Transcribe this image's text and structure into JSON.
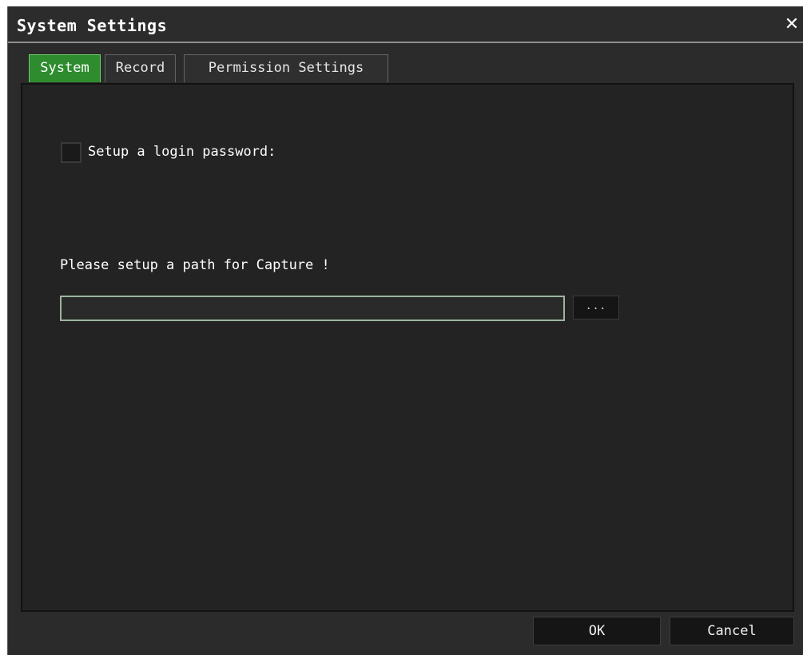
{
  "window": {
    "title": "System Settings",
    "close_glyph": "✕"
  },
  "tabs": [
    {
      "label": "System",
      "active": true
    },
    {
      "label": "Record",
      "active": false
    },
    {
      "label": "Permission Settings",
      "active": false
    }
  ],
  "system_tab": {
    "login_password_label": "Setup a login password:",
    "login_password_checked": false,
    "capture_path_label": "Please setup a path for Capture !",
    "capture_path_value": "",
    "browse_label": "..."
  },
  "footer": {
    "ok_label": "OK",
    "cancel_label": "Cancel"
  },
  "colors": {
    "background": "#2b2b2b",
    "active_tab": "#2e8b2e",
    "input_border": "#9cb59c",
    "text": "#ffffff"
  },
  "icons": {
    "close": "close-icon"
  }
}
